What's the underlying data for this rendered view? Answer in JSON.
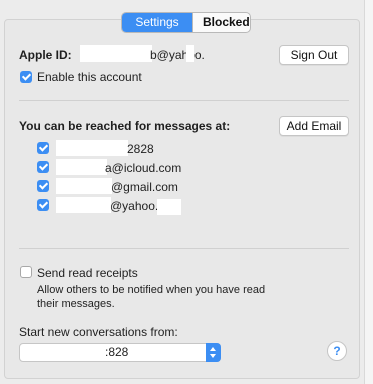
{
  "tabs": {
    "settings": "Settings",
    "blocked": "Blocked"
  },
  "account": {
    "apple_id_label": "Apple ID:",
    "apple_id_value": "b@yahoo.",
    "sign_out": "Sign Out",
    "enable_label": "Enable this account",
    "enable_checked": true
  },
  "reach": {
    "heading": "You can be reached for messages at:",
    "add_email": "Add Email",
    "items": [
      {
        "text": "2828",
        "checked": true
      },
      {
        "text": "a@icloud.com",
        "checked": true
      },
      {
        "text": "@gmail.com",
        "checked": true
      },
      {
        "text": "@yahoo.",
        "checked": true
      }
    ]
  },
  "receipts": {
    "label": "Send read receipts",
    "checked": false,
    "description": "Allow others to be notified when you have read their messages."
  },
  "start_from": {
    "label": "Start new conversations from:",
    "selected": ":828"
  },
  "help": "?"
}
